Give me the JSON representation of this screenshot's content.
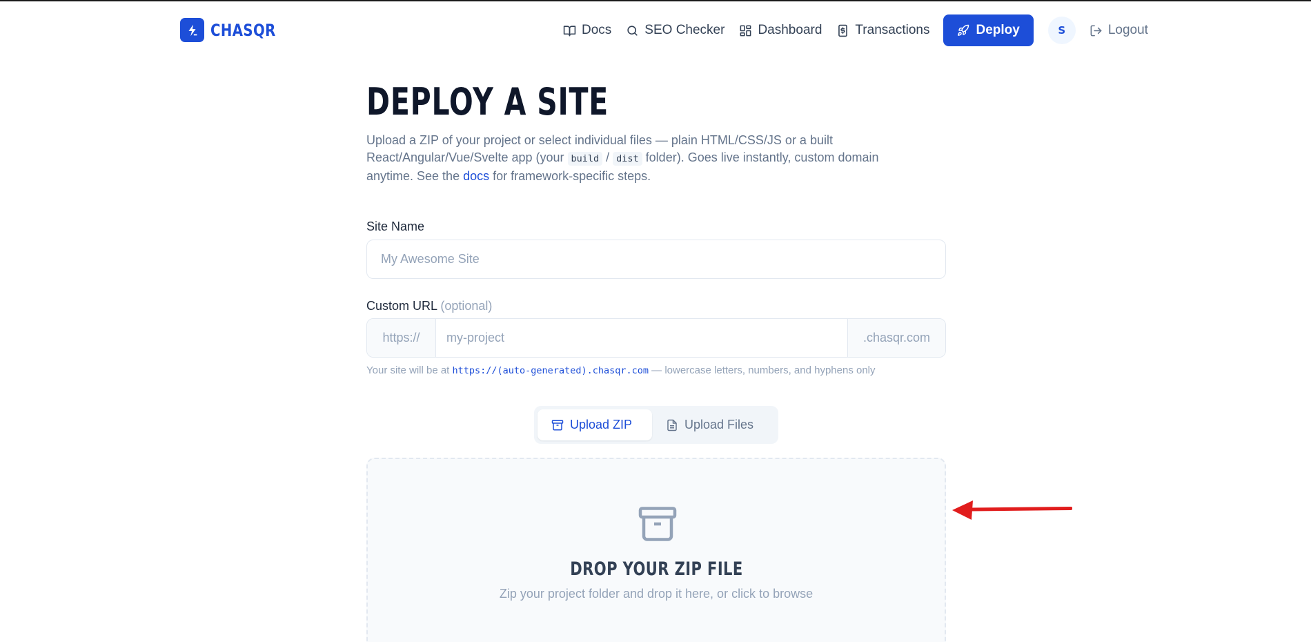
{
  "brand": {
    "name": "CHASQR",
    "color": "#1d4ed8"
  },
  "nav": {
    "links": [
      {
        "label": "Docs",
        "icon": "book-icon"
      },
      {
        "label": "SEO Checker",
        "icon": "search-icon"
      },
      {
        "label": "Dashboard",
        "icon": "grid-icon"
      },
      {
        "label": "Transactions",
        "icon": "receipt-icon"
      }
    ],
    "deploy_label": "Deploy",
    "avatar_initial": "S",
    "logout_label": "Logout"
  },
  "page": {
    "title": "DEPLOY A SITE",
    "intro_1": "Upload a ZIP of your project or select individual files — plain HTML/CSS/JS or a built React/Angular/Vue/Svelte app (your ",
    "intro_code_1": "build",
    "intro_sep": " / ",
    "intro_code_2": "dist",
    "intro_2": " folder). Goes live instantly, custom domain anytime. See the ",
    "intro_link": "docs",
    "intro_3": " for framework-specific steps."
  },
  "form": {
    "site_name_label": "Site Name",
    "site_name_placeholder": "My Awesome Site",
    "custom_url_label": "Custom URL",
    "custom_url_optional": "(optional)",
    "url_prefix": "https://",
    "url_placeholder": "my-project",
    "url_suffix": ".chasqr.com",
    "hint_1": "Your site will be at ",
    "hint_code": "https://(auto-generated).chasqr.com",
    "hint_2": " — lowercase letters, numbers, and hyphens only"
  },
  "upload": {
    "tabs": [
      {
        "label": "Upload ZIP",
        "active": true,
        "icon": "archive-icon"
      },
      {
        "label": "Upload Files",
        "active": false,
        "icon": "file-icon"
      }
    ],
    "drop_title": "DROP YOUR ZIP FILE",
    "drop_subtitle": "Zip your project folder and drop it here, or click to browse"
  },
  "colors": {
    "accent": "#1d4ed8",
    "annotation_arrow": "#e11d1d"
  }
}
